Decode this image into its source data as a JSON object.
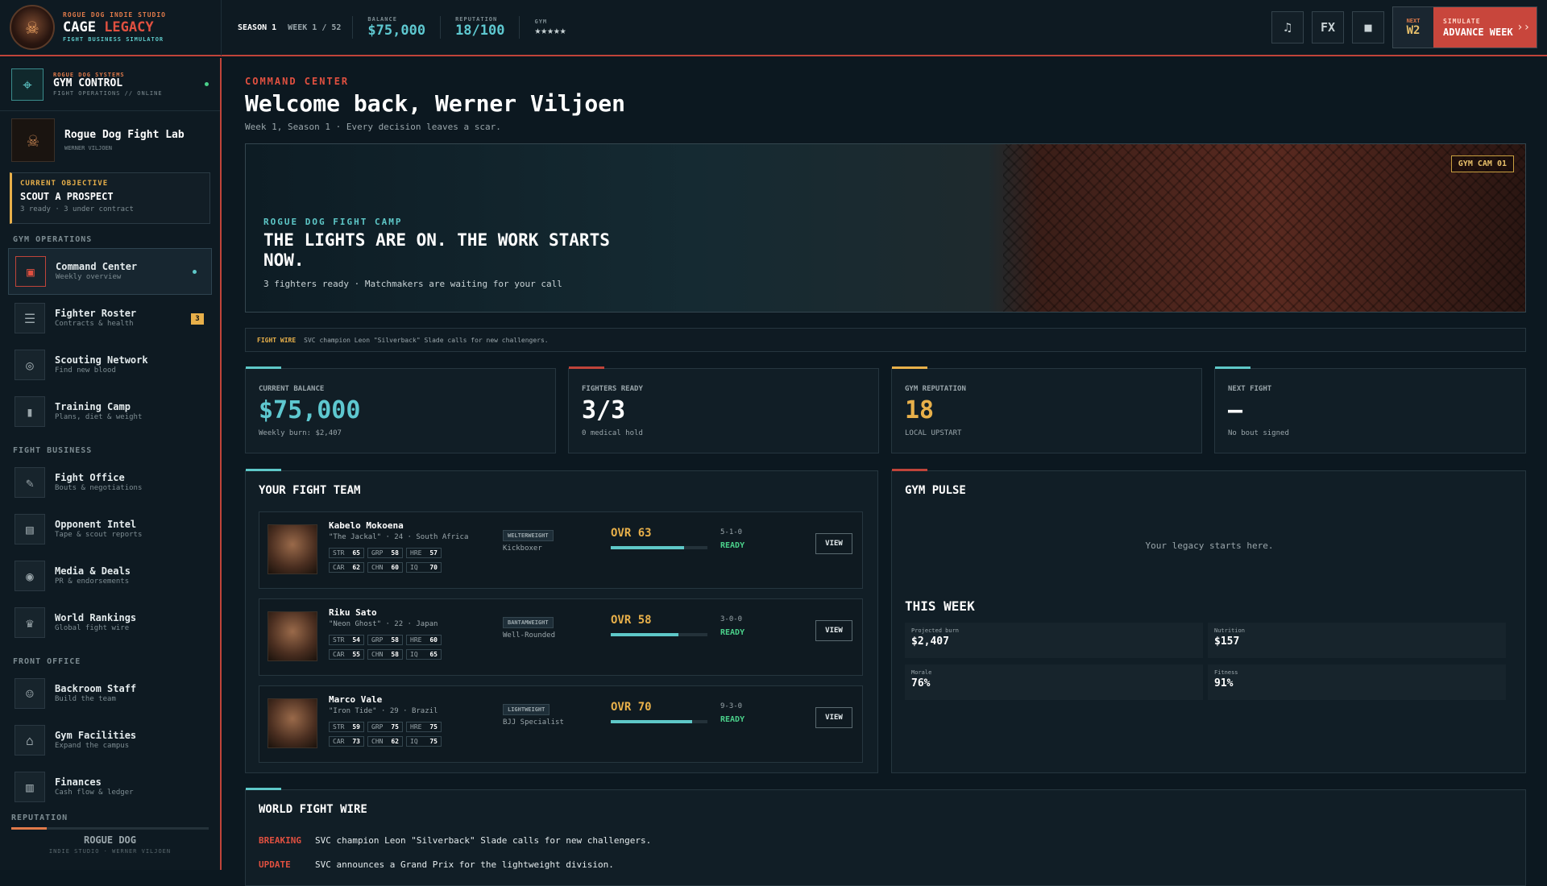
{
  "brand": {
    "studio": "ROGUE DOG INDIE STUDIO",
    "title_a": "CAGE ",
    "title_b": "LEGACY",
    "subtitle": "FIGHT BUSINESS SIMULATOR"
  },
  "top": {
    "season": "SEASON 1",
    "week": "WEEK 1 / 52",
    "balance_label": "BALANCE",
    "balance": "$75,000",
    "rep_label": "REPUTATION",
    "rep": "18/100",
    "gym_label": "GYM",
    "gym": "★★★★★",
    "music_icon": "♫",
    "fx": "FX",
    "stop_icon": "■",
    "next_label": "NEXT",
    "next_week": "W2",
    "sim_label": "SIMULATE",
    "advance": "ADVANCE WEEK",
    "arrow": "››"
  },
  "sidebar": {
    "gymctl": {
      "a": "ROGUE DOG SYSTEMS",
      "b": "GYM CONTROL",
      "c": "FIGHT OPERATIONS // ONLINE"
    },
    "gym": {
      "name": "Rogue Dog Fight Lab",
      "owner": "WERNER VILJOEN"
    },
    "objective": {
      "label": "CURRENT OBJECTIVE",
      "title": "SCOUT A PROSPECT",
      "sub": "3 ready · 3 under contract"
    },
    "groups": [
      "GYM OPERATIONS",
      "FIGHT BUSINESS",
      "FRONT OFFICE"
    ],
    "items": [
      {
        "label": "Command Center",
        "sub": "Weekly overview"
      },
      {
        "label": "Fighter Roster",
        "sub": "Contracts & health",
        "badge": "3"
      },
      {
        "label": "Scouting Network",
        "sub": "Find new blood"
      },
      {
        "label": "Training Camp",
        "sub": "Plans, diet & weight"
      },
      {
        "label": "Fight Office",
        "sub": "Bouts & negotiations"
      },
      {
        "label": "Opponent Intel",
        "sub": "Tape & scout reports"
      },
      {
        "label": "Media & Deals",
        "sub": "PR & endorsements"
      },
      {
        "label": "World Rankings",
        "sub": "Global fight wire"
      },
      {
        "label": "Backroom Staff",
        "sub": "Build the team"
      },
      {
        "label": "Gym Facilities",
        "sub": "Expand the campus"
      },
      {
        "label": "Finances",
        "sub": "Cash flow & ledger"
      }
    ],
    "rep": {
      "label": "REPUTATION",
      "level": 0.18,
      "footer": "ROGUE DOG",
      "footer_sub": "INDIE STUDIO · WERNER VILJOEN"
    }
  },
  "header": {
    "kicker": "COMMAND CENTER",
    "title": "Welcome back, Werner Viljoen",
    "sub": "Week 1, Season 1 · Every decision leaves a scar."
  },
  "hero": {
    "cam": "GYM CAM 01",
    "kicker": "ROGUE DOG FIGHT CAMP",
    "headline": "THE LIGHTS ARE ON. THE WORK STARTS NOW.",
    "sub": "3 fighters ready · Matchmakers are waiting for your call"
  },
  "wire_ticker": {
    "label": "FIGHT WIRE",
    "msg": "SVC champion Leon \"Silverback\" Slade calls for new challengers."
  },
  "kpis": [
    {
      "label": "CURRENT BALANCE",
      "value": "$75,000",
      "sub": "Weekly burn: $2,407",
      "color": "#5ec8d0",
      "line": "#5ec8c8"
    },
    {
      "label": "FIGHTERS READY",
      "value": "3/3",
      "sub": "0 medical hold",
      "color": "#ffffff",
      "line": "#c0443a"
    },
    {
      "label": "GYM REPUTATION",
      "value": "18",
      "sub": "LOCAL UPSTART",
      "color": "#e8b04a",
      "line": "#e8b04a"
    },
    {
      "label": "NEXT FIGHT",
      "value": "—",
      "sub": "No bout signed",
      "color": "#ffffff",
      "line": "#5ec8c8"
    }
  ],
  "team": {
    "title": "YOUR FIGHT TEAM",
    "view": "VIEW",
    "fighters": [
      {
        "name": "Kabelo Mokoena",
        "nick": "\"The Jackal\" · 24 · South Africa",
        "weight": "WELTERWEIGHT",
        "style": "Kickboxer",
        "ovr": "OVR 63",
        "ovr_val": 63,
        "record": "5-1-0",
        "status": "READY",
        "stats": [
          [
            "STR",
            "65"
          ],
          [
            "GRP",
            "58"
          ],
          [
            "HRE",
            "57"
          ],
          [
            "CAR",
            "62"
          ],
          [
            "CHN",
            "60"
          ],
          [
            "IQ",
            "70"
          ]
        ]
      },
      {
        "name": "Riku Sato",
        "nick": "\"Neon Ghost\" · 22 · Japan",
        "weight": "BANTAMWEIGHT",
        "style": "Well-Rounded",
        "ovr": "OVR 58",
        "ovr_val": 58,
        "record": "3-0-0",
        "status": "READY",
        "stats": [
          [
            "STR",
            "54"
          ],
          [
            "GRP",
            "58"
          ],
          [
            "HRE",
            "60"
          ],
          [
            "CAR",
            "55"
          ],
          [
            "CHN",
            "58"
          ],
          [
            "IQ",
            "65"
          ]
        ]
      },
      {
        "name": "Marco Vale",
        "nick": "\"Iron Tide\" · 29 · Brazil",
        "weight": "LIGHTWEIGHT",
        "style": "BJJ Specialist",
        "ovr": "OVR 70",
        "ovr_val": 70,
        "record": "9-3-0",
        "status": "READY",
        "stats": [
          [
            "STR",
            "59"
          ],
          [
            "GRP",
            "75"
          ],
          [
            "HRE",
            "75"
          ],
          [
            "CAR",
            "73"
          ],
          [
            "CHN",
            "62"
          ],
          [
            "IQ",
            "75"
          ]
        ]
      }
    ]
  },
  "pulse": {
    "title": "GYM PULSE",
    "empty": "Your legacy starts here.",
    "week_title": "THIS WEEK",
    "cells": [
      {
        "label": "Projected burn",
        "value": "$2,407"
      },
      {
        "label": "Nutrition",
        "value": "$157"
      },
      {
        "label": "Morale",
        "value": "76%"
      },
      {
        "label": "Fitness",
        "value": "91%"
      }
    ]
  },
  "world_wire": {
    "title": "WORLD FIGHT WIRE",
    "rows": [
      {
        "tag": "BREAKING",
        "msg": "SVC champion Leon \"Silverback\" Slade calls for new challengers."
      },
      {
        "tag": "UPDATE",
        "msg": "SVC announces a Grand Prix for the lightweight division."
      }
    ]
  }
}
